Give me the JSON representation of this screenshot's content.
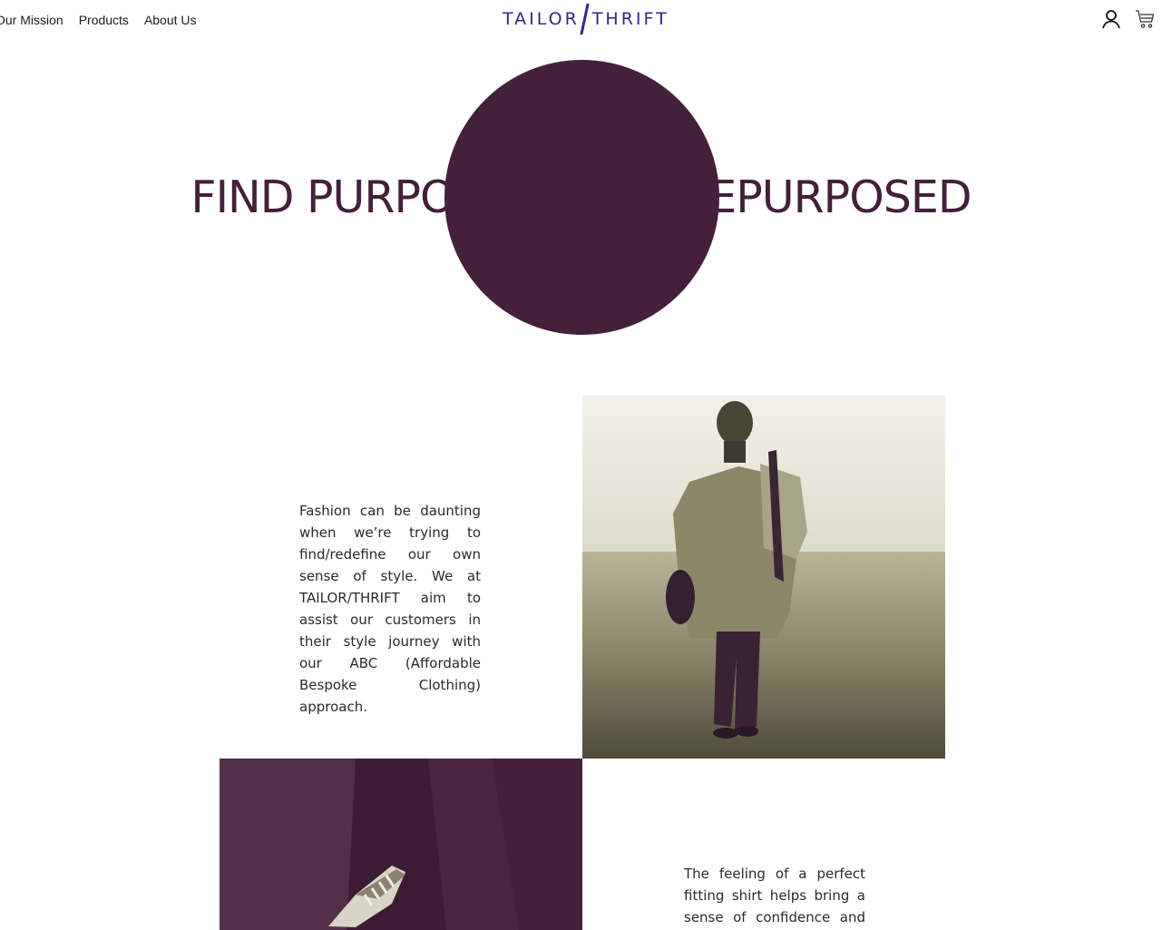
{
  "header": {
    "nav": [
      {
        "label": "Our Mission"
      },
      {
        "label": "Products"
      },
      {
        "label": "About Us"
      }
    ],
    "logo": {
      "left": "TAILOR",
      "right": "THRIFT"
    },
    "icons": [
      "user-icon",
      "cart-icon"
    ]
  },
  "hero": {
    "title": "FIND PURPOSE IN THE REPURPOSED",
    "accent_color": "#44203a"
  },
  "sections": [
    {
      "text": "Fashion can be daunting when we’re trying to find/redefine our own sense of style. We at TAILOR/THRIFT aim to assist our customers in their style journey with our ABC (Affordable Bespoke Clothing) approach."
    },
    {
      "text": "The feeling of a perfect fitting shirt helps bring a sense of confidence and assurance to where ever"
    }
  ],
  "colors": {
    "brand": "#2d2a86",
    "accent": "#44203a"
  }
}
